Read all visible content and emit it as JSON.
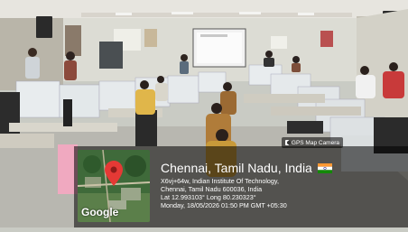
{
  "overlay": {
    "app_badge": "GPS Map Camera",
    "map_brand": "Google",
    "place_title": "Chennai, Tamil Nadu, India",
    "address_line1": "X6vj+64w, Indian Institute Of Technology,",
    "address_line2": "Chennai, Tamil Nadu 600036, India",
    "coordinates": "Lat 12.993103° Long 80.230323°",
    "timestamp": "Monday, 18/05/2026 01:50 PM GMT +05:30"
  }
}
